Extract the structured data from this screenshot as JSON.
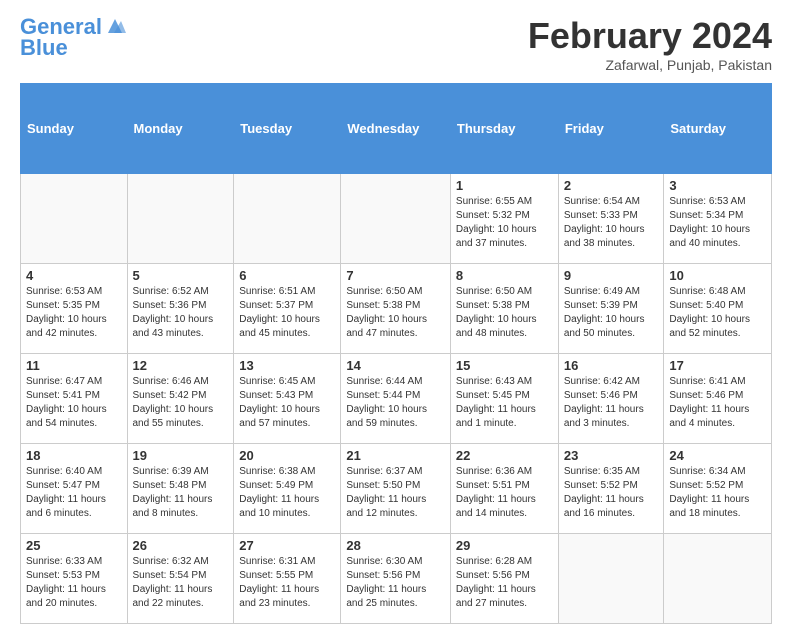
{
  "header": {
    "logo_line1": "General",
    "logo_line2": "Blue",
    "month_title": "February 2024",
    "location": "Zafarwal, Punjab, Pakistan"
  },
  "weekdays": [
    "Sunday",
    "Monday",
    "Tuesday",
    "Wednesday",
    "Thursday",
    "Friday",
    "Saturday"
  ],
  "weeks": [
    [
      {
        "day": "",
        "info": ""
      },
      {
        "day": "",
        "info": ""
      },
      {
        "day": "",
        "info": ""
      },
      {
        "day": "",
        "info": ""
      },
      {
        "day": "1",
        "info": "Sunrise: 6:55 AM\nSunset: 5:32 PM\nDaylight: 10 hours\nand 37 minutes."
      },
      {
        "day": "2",
        "info": "Sunrise: 6:54 AM\nSunset: 5:33 PM\nDaylight: 10 hours\nand 38 minutes."
      },
      {
        "day": "3",
        "info": "Sunrise: 6:53 AM\nSunset: 5:34 PM\nDaylight: 10 hours\nand 40 minutes."
      }
    ],
    [
      {
        "day": "4",
        "info": "Sunrise: 6:53 AM\nSunset: 5:35 PM\nDaylight: 10 hours\nand 42 minutes."
      },
      {
        "day": "5",
        "info": "Sunrise: 6:52 AM\nSunset: 5:36 PM\nDaylight: 10 hours\nand 43 minutes."
      },
      {
        "day": "6",
        "info": "Sunrise: 6:51 AM\nSunset: 5:37 PM\nDaylight: 10 hours\nand 45 minutes."
      },
      {
        "day": "7",
        "info": "Sunrise: 6:50 AM\nSunset: 5:38 PM\nDaylight: 10 hours\nand 47 minutes."
      },
      {
        "day": "8",
        "info": "Sunrise: 6:50 AM\nSunset: 5:38 PM\nDaylight: 10 hours\nand 48 minutes."
      },
      {
        "day": "9",
        "info": "Sunrise: 6:49 AM\nSunset: 5:39 PM\nDaylight: 10 hours\nand 50 minutes."
      },
      {
        "day": "10",
        "info": "Sunrise: 6:48 AM\nSunset: 5:40 PM\nDaylight: 10 hours\nand 52 minutes."
      }
    ],
    [
      {
        "day": "11",
        "info": "Sunrise: 6:47 AM\nSunset: 5:41 PM\nDaylight: 10 hours\nand 54 minutes."
      },
      {
        "day": "12",
        "info": "Sunrise: 6:46 AM\nSunset: 5:42 PM\nDaylight: 10 hours\nand 55 minutes."
      },
      {
        "day": "13",
        "info": "Sunrise: 6:45 AM\nSunset: 5:43 PM\nDaylight: 10 hours\nand 57 minutes."
      },
      {
        "day": "14",
        "info": "Sunrise: 6:44 AM\nSunset: 5:44 PM\nDaylight: 10 hours\nand 59 minutes."
      },
      {
        "day": "15",
        "info": "Sunrise: 6:43 AM\nSunset: 5:45 PM\nDaylight: 11 hours\nand 1 minute."
      },
      {
        "day": "16",
        "info": "Sunrise: 6:42 AM\nSunset: 5:46 PM\nDaylight: 11 hours\nand 3 minutes."
      },
      {
        "day": "17",
        "info": "Sunrise: 6:41 AM\nSunset: 5:46 PM\nDaylight: 11 hours\nand 4 minutes."
      }
    ],
    [
      {
        "day": "18",
        "info": "Sunrise: 6:40 AM\nSunset: 5:47 PM\nDaylight: 11 hours\nand 6 minutes."
      },
      {
        "day": "19",
        "info": "Sunrise: 6:39 AM\nSunset: 5:48 PM\nDaylight: 11 hours\nand 8 minutes."
      },
      {
        "day": "20",
        "info": "Sunrise: 6:38 AM\nSunset: 5:49 PM\nDaylight: 11 hours\nand 10 minutes."
      },
      {
        "day": "21",
        "info": "Sunrise: 6:37 AM\nSunset: 5:50 PM\nDaylight: 11 hours\nand 12 minutes."
      },
      {
        "day": "22",
        "info": "Sunrise: 6:36 AM\nSunset: 5:51 PM\nDaylight: 11 hours\nand 14 minutes."
      },
      {
        "day": "23",
        "info": "Sunrise: 6:35 AM\nSunset: 5:52 PM\nDaylight: 11 hours\nand 16 minutes."
      },
      {
        "day": "24",
        "info": "Sunrise: 6:34 AM\nSunset: 5:52 PM\nDaylight: 11 hours\nand 18 minutes."
      }
    ],
    [
      {
        "day": "25",
        "info": "Sunrise: 6:33 AM\nSunset: 5:53 PM\nDaylight: 11 hours\nand 20 minutes."
      },
      {
        "day": "26",
        "info": "Sunrise: 6:32 AM\nSunset: 5:54 PM\nDaylight: 11 hours\nand 22 minutes."
      },
      {
        "day": "27",
        "info": "Sunrise: 6:31 AM\nSunset: 5:55 PM\nDaylight: 11 hours\nand 23 minutes."
      },
      {
        "day": "28",
        "info": "Sunrise: 6:30 AM\nSunset: 5:56 PM\nDaylight: 11 hours\nand 25 minutes."
      },
      {
        "day": "29",
        "info": "Sunrise: 6:28 AM\nSunset: 5:56 PM\nDaylight: 11 hours\nand 27 minutes."
      },
      {
        "day": "",
        "info": ""
      },
      {
        "day": "",
        "info": ""
      }
    ]
  ]
}
